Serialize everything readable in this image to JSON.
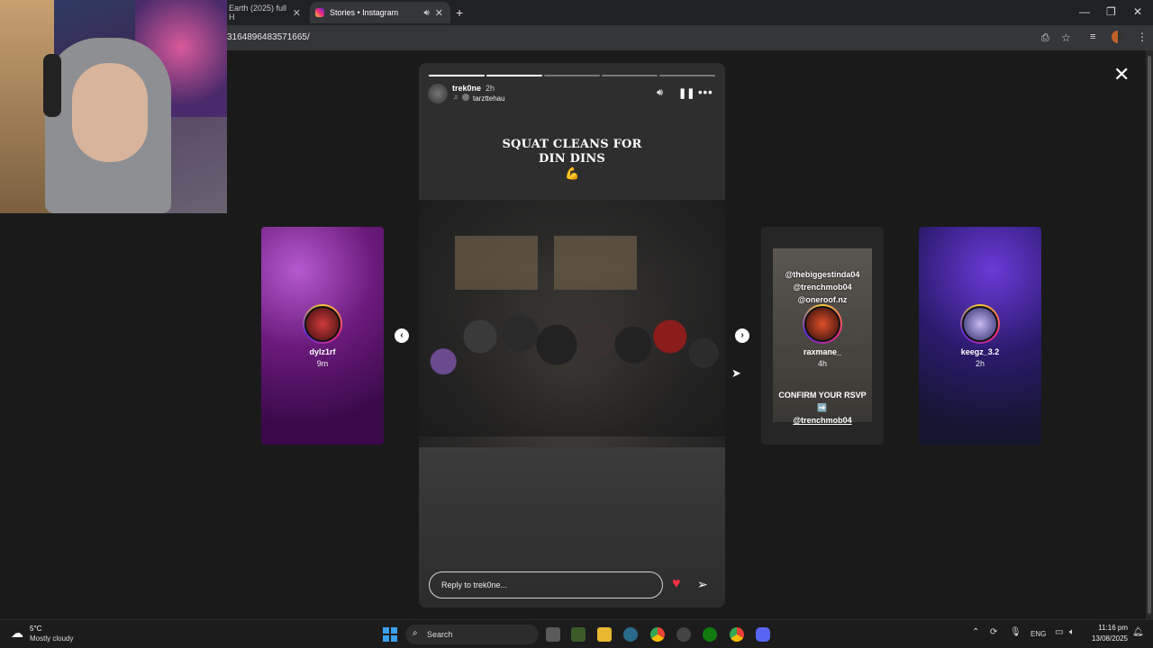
{
  "browser": {
    "tabs": [
      {
        "title": "Earth (2025) full H",
        "active": false
      },
      {
        "title": "Stories • Instagram",
        "active": true
      }
    ],
    "url": "3164896483571665/"
  },
  "story": {
    "username": "trek0ne",
    "time": "2h",
    "music_credit": "tarzttehau",
    "headline_line1": "SQUAT CLEANS FOR",
    "headline_line2": "DIN DINS",
    "emoji": "💪",
    "progress_segments": 5,
    "active_segment_index": 1,
    "active_segment_progress": 1.0,
    "reply_placeholder": "Reply to trek0ne..."
  },
  "side_stories": [
    {
      "username": "dylz1rf",
      "time": "9m"
    },
    {
      "username": "raxmane_",
      "time": "4h",
      "overlay_lines": [
        "@thebiggestinda04",
        "@trenchmob04",
        "@oneroof.nz"
      ],
      "cta_line1": "CONFIRM YOUR RSVP ➡️",
      "cta_line2": "@trenchmob04"
    },
    {
      "username": "keegz_3.2",
      "time": "2h"
    }
  ],
  "taskbar": {
    "weather_temp": "5°C",
    "weather_text": "Mostly cloudy",
    "search_label": "Search",
    "language": "ENG",
    "time": "11:16 pm",
    "date": "13/08/2025"
  },
  "colors": {
    "heart": "#ff3040",
    "stage_bg": "#1a1a1a",
    "story_bg": "#2e2e2e"
  }
}
